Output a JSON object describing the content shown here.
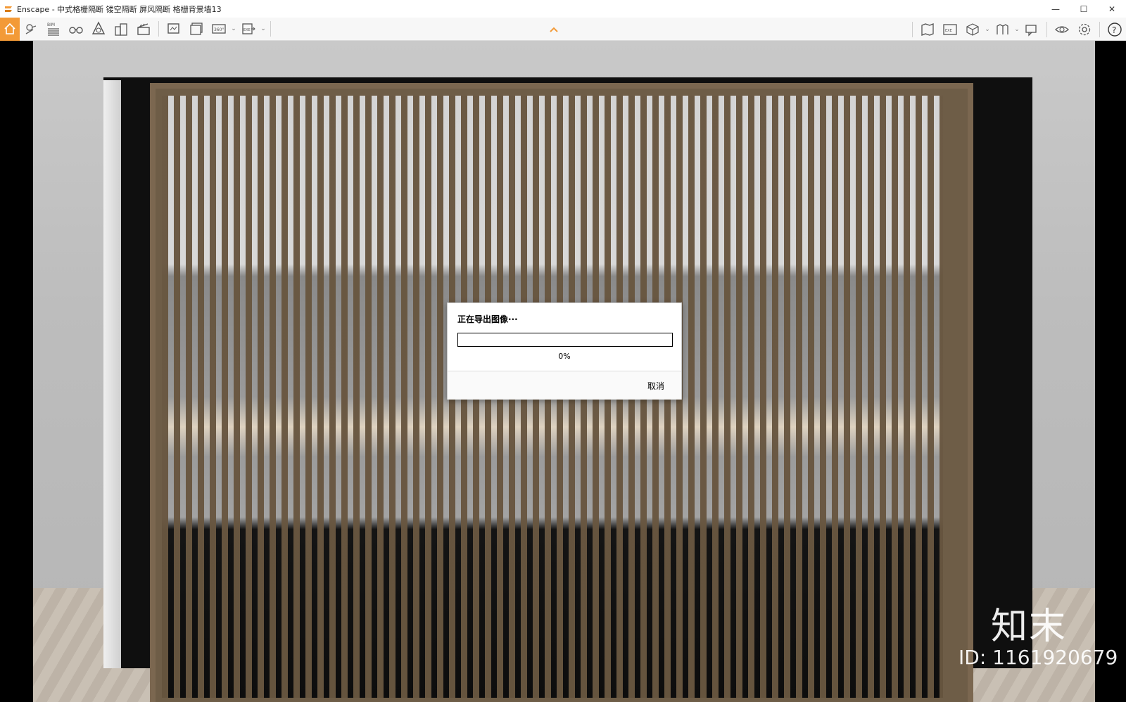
{
  "window": {
    "title": "Enscape - 中式格栅隔断 镂空隔断 屏风隔断 格栅背景墙13",
    "minimize_glyph": "—",
    "maximize_glyph": "☐",
    "close_glyph": "✕"
  },
  "toolbar": {
    "accent_color": "#f39a37",
    "left_buttons": [
      {
        "icon": "home-icon"
      },
      {
        "icon": "map-pin-icon"
      },
      {
        "icon": "bim-icon",
        "label": "BIM"
      },
      {
        "icon": "binoculars-icon"
      },
      {
        "icon": "light-view-icon"
      },
      {
        "icon": "buildings-icon"
      },
      {
        "icon": "clapperboard-icon"
      }
    ],
    "export_buttons": [
      {
        "icon": "screenshot-icon"
      },
      {
        "icon": "batch-render-icon"
      },
      {
        "icon": "panorama-360-icon",
        "label": "360°"
      },
      {
        "icon": "export-exe-icon",
        "label": "EXE"
      }
    ],
    "right_buttons": [
      {
        "icon": "map-view-icon"
      },
      {
        "icon": "export-web-icon",
        "label": "EXE"
      },
      {
        "icon": "cube-view-icon"
      },
      {
        "icon": "asset-library-icon"
      },
      {
        "icon": "chat-icon"
      },
      {
        "icon": "eye-icon"
      },
      {
        "icon": "gear-icon"
      },
      {
        "icon": "help-icon",
        "label": "?"
      }
    ]
  },
  "dialog": {
    "title": "正在导出图像···",
    "progress": 0,
    "progress_label": "0%",
    "cancel_label": "取消"
  },
  "watermark": {
    "logo": "知末",
    "id_text": "ID: 1161920679"
  }
}
